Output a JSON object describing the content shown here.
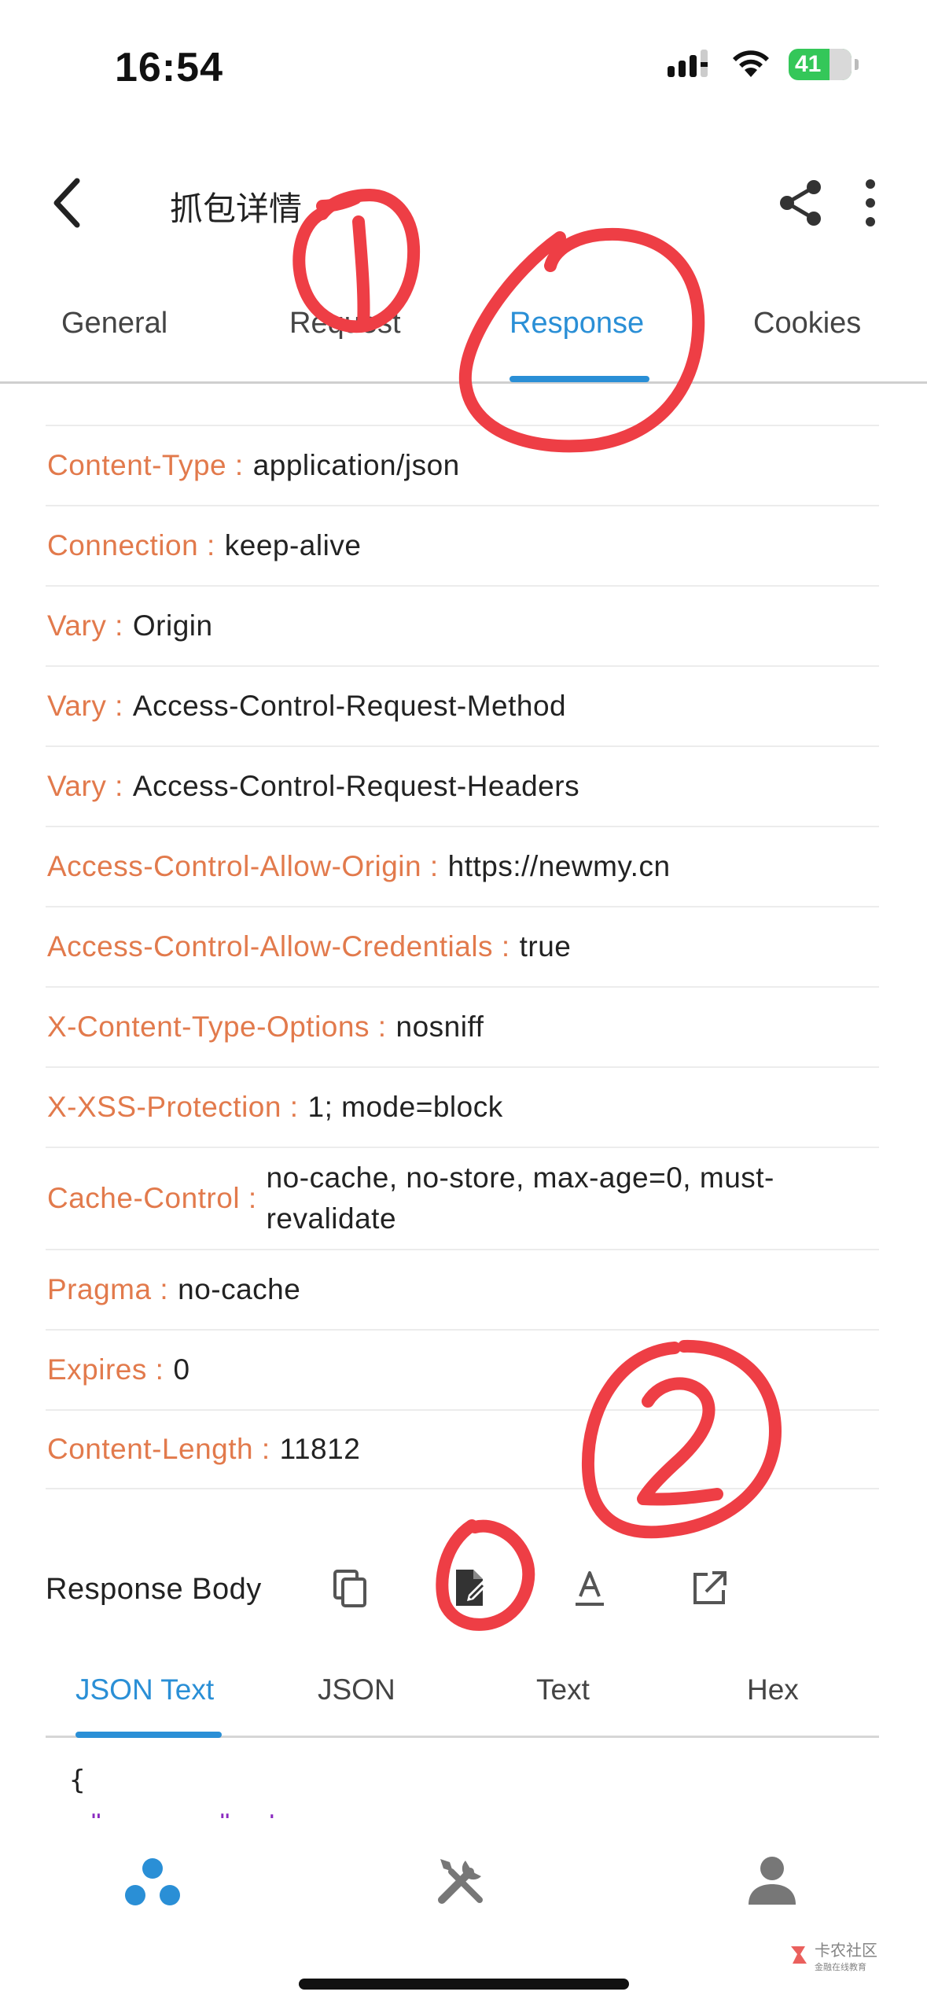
{
  "status_bar": {
    "time": "16:54",
    "battery_level": "41"
  },
  "app_bar": {
    "title": "抓包详情",
    "back_icon": "chevron-left-icon",
    "share_icon": "share-icon",
    "more_icon": "more-vertical-icon"
  },
  "tabs": [
    {
      "label": "General",
      "active": false
    },
    {
      "label": "Request",
      "active": false
    },
    {
      "label": "Response",
      "active": true
    },
    {
      "label": "Cookies",
      "active": false
    }
  ],
  "headers": [
    {
      "key": "Content-Type :",
      "value": "application/json"
    },
    {
      "key": "Connection :",
      "value": "keep-alive"
    },
    {
      "key": "Vary :",
      "value": "Origin"
    },
    {
      "key": "Vary :",
      "value": "Access-Control-Request-Method"
    },
    {
      "key": "Vary :",
      "value": "Access-Control-Request-Headers"
    },
    {
      "key": "Access-Control-Allow-Origin :",
      "value": "https://newmy.cn"
    },
    {
      "key": "Access-Control-Allow-Credentials :",
      "value": "true"
    },
    {
      "key": "X-Content-Type-Options :",
      "value": "nosniff"
    },
    {
      "key": "X-XSS-Protection :",
      "value": "1; mode=block"
    },
    {
      "key": "Cache-Control :",
      "value": "no-cache, no-store, max-age=0, must-revalidate"
    },
    {
      "key": "Pragma :",
      "value": "no-cache"
    },
    {
      "key": "Expires :",
      "value": "0"
    },
    {
      "key": "Content-Length :",
      "value": "11812"
    }
  ],
  "response_body": {
    "label": "Response Body",
    "actions": [
      "copy-icon",
      "edit-document-icon",
      "text-format-icon",
      "open-external-icon"
    ]
  },
  "body_tabs": [
    {
      "label": "JSON Text",
      "active": true
    },
    {
      "label": "JSON",
      "active": false
    },
    {
      "label": "Text",
      "active": false
    },
    {
      "label": "Hex",
      "active": false
    }
  ],
  "json_preview": {
    "line1": "{",
    "line2": "\"success\": true"
  },
  "bottom_nav": [
    "capture-icon",
    "tools-icon",
    "profile-icon"
  ],
  "annotations": {
    "mark1": "①",
    "mark2": "②"
  },
  "watermark": {
    "text": "卡农社区",
    "subtext": "金融在线教育"
  },
  "colors": {
    "accent": "#2a8fd6",
    "header_key": "#e27a4c",
    "annotation": "#ee3e45"
  }
}
